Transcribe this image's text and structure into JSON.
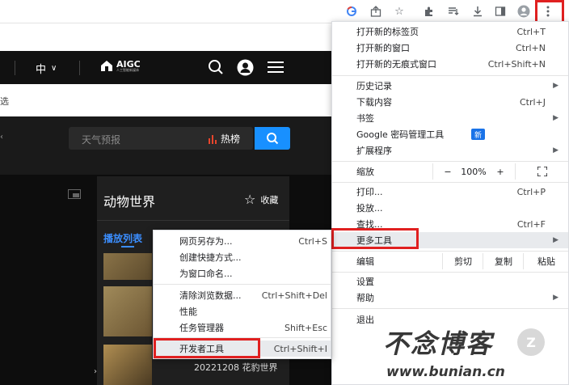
{
  "toolbar": {
    "icons": [
      "google-icon",
      "share-icon",
      "star-icon",
      "extensions-icon",
      "reading-list-icon",
      "download-icon",
      "side-panel-icon",
      "profile-icon",
      "kebab-menu-icon"
    ]
  },
  "site": {
    "language": "中",
    "logo_text": "AIGC",
    "logo_subtext": "人工智能新媒体",
    "sub_bar_char": "选",
    "search_placeholder": "天气预报",
    "hot_label": "热榜",
    "panel_title": "动物世界",
    "collect_label": "收藏",
    "playlist_tab": "播放列表",
    "video_caption": "20221208 花豹世界",
    "colors": {
      "search_button": "#1890ff",
      "hot_icon": "#e8452c"
    }
  },
  "main_menu": {
    "new_tab": {
      "label": "打开新的标签页",
      "shortcut": "Ctrl+T"
    },
    "new_window": {
      "label": "打开新的窗口",
      "shortcut": "Ctrl+N"
    },
    "incognito": {
      "label": "打开新的无痕式窗口",
      "shortcut": "Ctrl+Shift+N"
    },
    "history": {
      "label": "历史记录"
    },
    "downloads": {
      "label": "下载内容",
      "shortcut": "Ctrl+J"
    },
    "bookmarks": {
      "label": "书签"
    },
    "passwords": {
      "label": "Google 密码管理工具",
      "badge": "新"
    },
    "extensions": {
      "label": "扩展程序"
    },
    "zoom": {
      "label": "缩放",
      "minus": "−",
      "value": "100%",
      "plus": "+"
    },
    "print": {
      "label": "打印...",
      "shortcut": "Ctrl+P"
    },
    "cast": {
      "label": "投放..."
    },
    "find": {
      "label": "查找...",
      "shortcut": "Ctrl+F"
    },
    "more_tools": {
      "label": "更多工具"
    },
    "edit": {
      "label": "编辑",
      "cut": "剪切",
      "copy": "复制",
      "paste": "粘贴"
    },
    "settings": {
      "label": "设置"
    },
    "help": {
      "label": "帮助"
    },
    "exit": {
      "label": "退出"
    }
  },
  "sub_menu": {
    "save_page": {
      "label": "网页另存为...",
      "shortcut": "Ctrl+S"
    },
    "create_shortcut": {
      "label": "创建快捷方式..."
    },
    "name_window": {
      "label": "为窗口命名..."
    },
    "clear_data": {
      "label": "清除浏览数据...",
      "shortcut": "Ctrl+Shift+Del"
    },
    "performance": {
      "label": "性能"
    },
    "task_manager": {
      "label": "任务管理器",
      "shortcut": "Shift+Esc"
    },
    "dev_tools": {
      "label": "开发者工具",
      "shortcut": "Ctrl+Shift+I"
    }
  },
  "watermark": {
    "title": "不念博客",
    "url": "www.bunian.cn"
  },
  "accent": {
    "highlight": "#e02020"
  }
}
